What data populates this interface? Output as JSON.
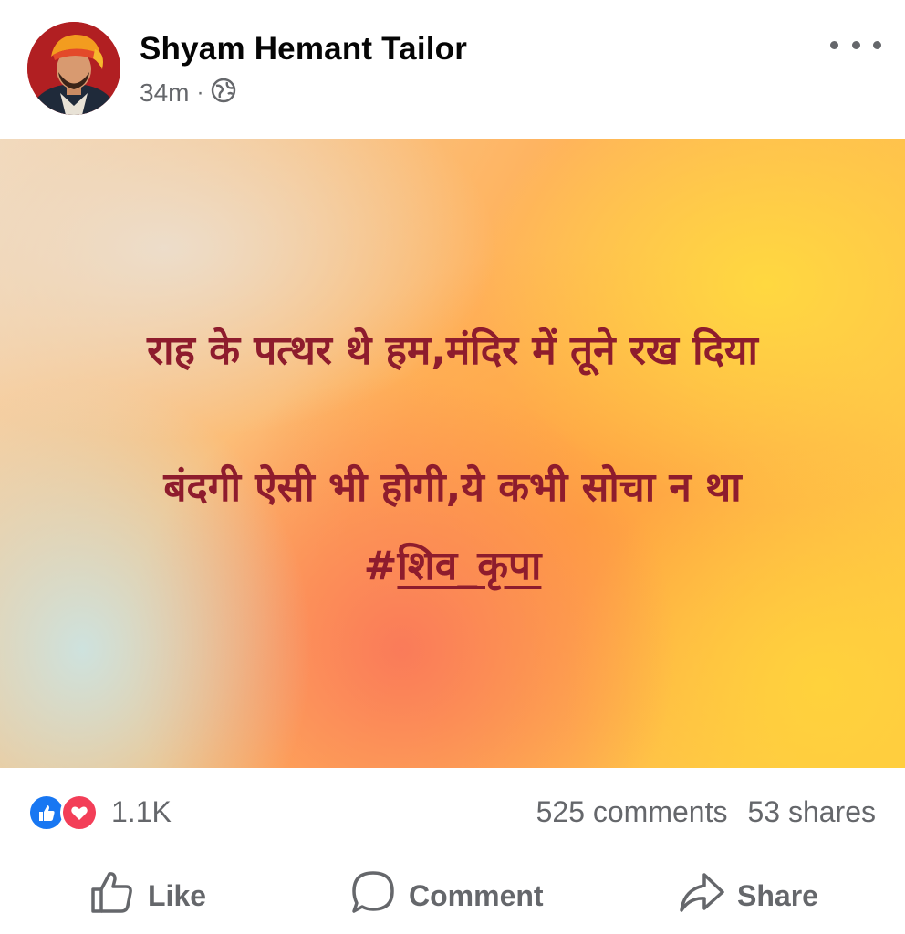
{
  "header": {
    "author_name": "Shyam Hemant Tailor",
    "timestamp": "34m",
    "separator": "·",
    "privacy_icon": "globe-icon",
    "more_icon": "more-horizontal-icon"
  },
  "post": {
    "lines": [
      "राह के पत्थर थे हम,मंदिर में तूने रख दिया",
      "बंदगी ऐसी भी होगी,ये कभी सोचा न था"
    ],
    "hashtag_prefix": "#",
    "hashtag_text": "शिव_कृपा",
    "text_color": "#8e1c2d"
  },
  "reactions": {
    "icons": [
      "like-reaction-icon",
      "love-reaction-icon"
    ],
    "count": "1.1K",
    "comments": "525 comments",
    "shares": "53 shares"
  },
  "actions": {
    "like": "Like",
    "comment": "Comment",
    "share": "Share"
  },
  "colors": {
    "like_blue": "#1877f2",
    "love_red": "#f33e58",
    "secondary_text": "#65676b"
  }
}
